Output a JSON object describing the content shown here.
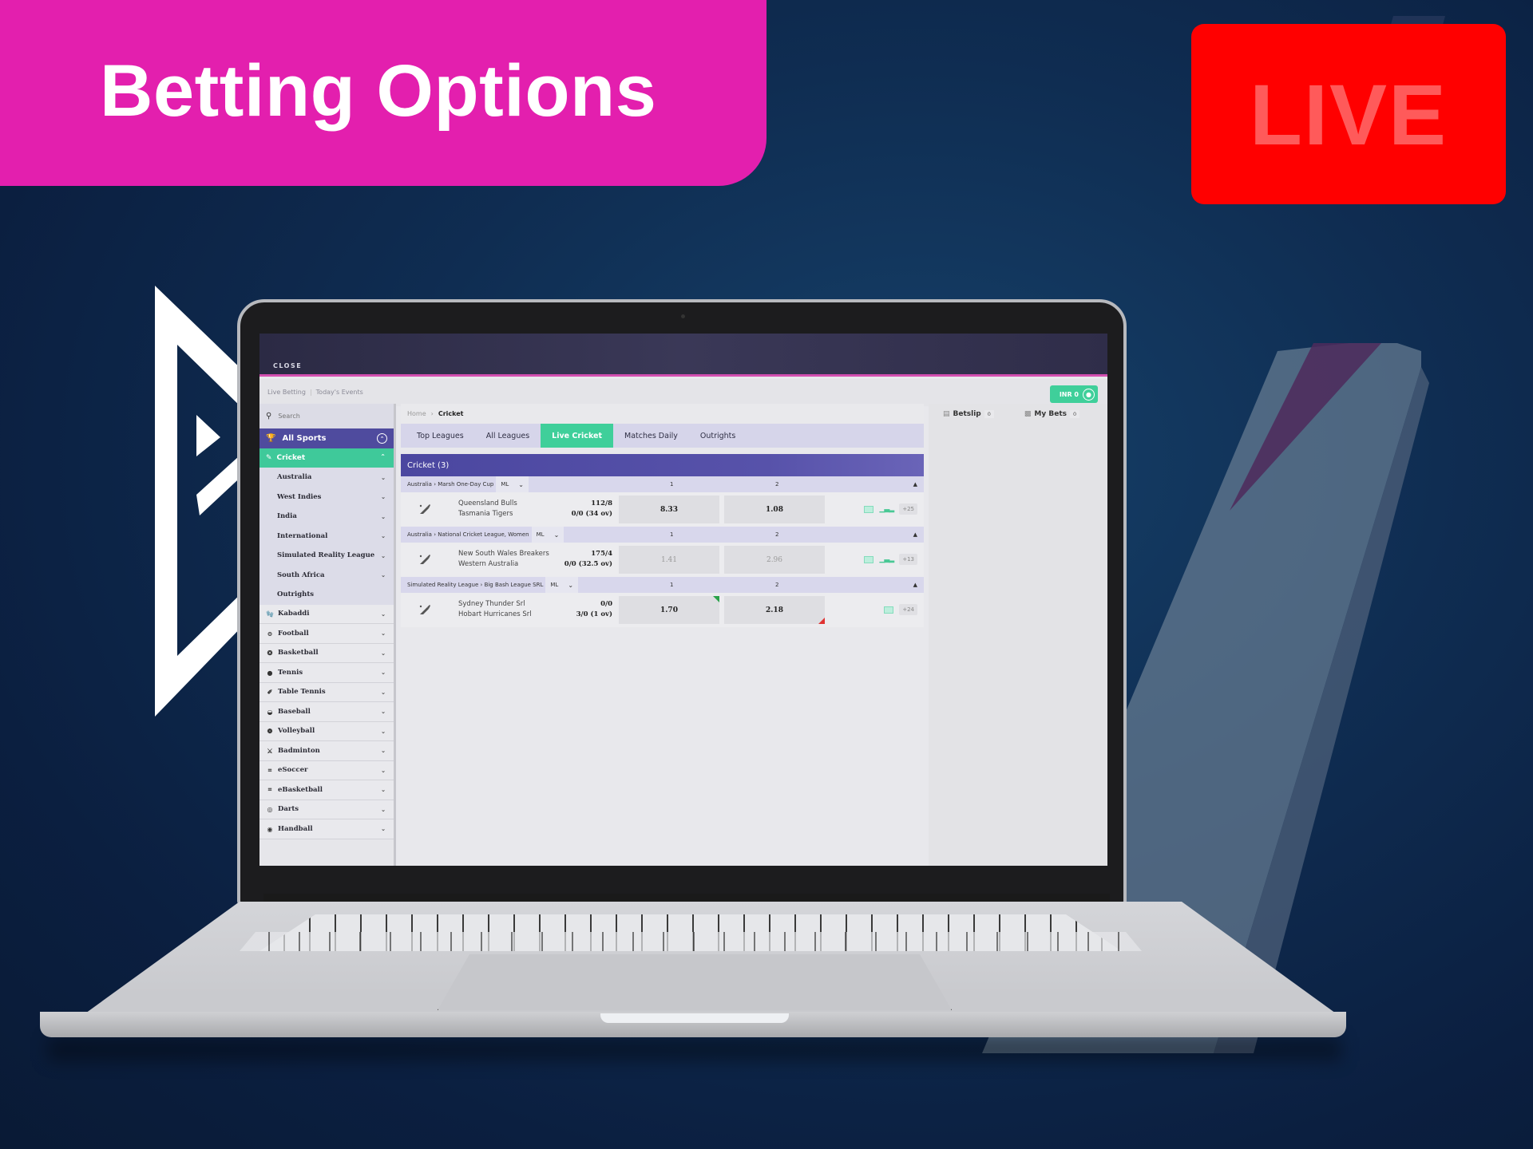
{
  "banner": {
    "title": "Betting Options"
  },
  "live_badge": {
    "label": "LIVE"
  },
  "colors": {
    "banner_bg": "#e31fae",
    "live_bg": "#ff0000",
    "accent_green": "#3fcf9a",
    "accent_purple": "#4f4b9e"
  },
  "app": {
    "close_label": "CLOSE",
    "crumbs": [
      "Live Betting",
      "Today's Events"
    ],
    "balance_label": "INR 0",
    "search_placeholder": "Search",
    "sidebar": {
      "all_sports": "All Sports",
      "active_sport": "Cricket",
      "sub_items": [
        {
          "label": "Australia",
          "has_chevron": true
        },
        {
          "label": "West Indies",
          "has_chevron": true
        },
        {
          "label": "India",
          "has_chevron": true
        },
        {
          "label": "International",
          "has_chevron": true
        },
        {
          "label": "Simulated Reality League",
          "has_chevron": true
        },
        {
          "label": "South Africa",
          "has_chevron": true
        },
        {
          "label": "Outrights",
          "has_chevron": false
        }
      ],
      "sports": [
        {
          "label": "Kabaddi",
          "icon": "kabaddi-icon"
        },
        {
          "label": "Football",
          "icon": "football-icon"
        },
        {
          "label": "Basketball",
          "icon": "basketball-icon"
        },
        {
          "label": "Tennis",
          "icon": "tennis-icon"
        },
        {
          "label": "Table Tennis",
          "icon": "table-tennis-icon"
        },
        {
          "label": "Baseball",
          "icon": "baseball-icon"
        },
        {
          "label": "Volleyball",
          "icon": "volleyball-icon"
        },
        {
          "label": "Badminton",
          "icon": "badminton-icon"
        },
        {
          "label": "eSoccer",
          "icon": "esoccer-icon"
        },
        {
          "label": "eBasketball",
          "icon": "ebasketball-icon"
        },
        {
          "label": "Darts",
          "icon": "darts-icon"
        },
        {
          "label": "Handball",
          "icon": "handball-icon"
        }
      ]
    },
    "breadcrumb": {
      "home": "Home",
      "current": "Cricket"
    },
    "tabs": [
      {
        "label": "Top Leagues",
        "active": false
      },
      {
        "label": "All Leagues",
        "active": false
      },
      {
        "label": "Live Cricket",
        "active": true
      },
      {
        "label": "Matches Daily",
        "active": false
      },
      {
        "label": "Outrights",
        "active": false
      }
    ],
    "category": "Cricket (3)",
    "col_headers": [
      "1",
      "2"
    ],
    "market": "ML",
    "leagues": [
      {
        "path": [
          "Australia",
          "Marsh One-Day Cup"
        ],
        "match": {
          "team1": "Queensland Bulls",
          "team2": "Tasmania Tigers",
          "score1": "112/8",
          "score2": "0/0 (34 ov)",
          "odd1": "8.33",
          "odd2": "1.08",
          "suspended": false,
          "odd1_trend": "",
          "odd2_trend": "",
          "has_field": true,
          "has_stats": true,
          "more_markets": "+25"
        }
      },
      {
        "path": [
          "Australia",
          "National Cricket League, Women"
        ],
        "match": {
          "team1": "New South Wales Breakers",
          "team2": "Western Australia",
          "score1": "175/4",
          "score2": "0/0 (32.5 ov)",
          "odd1": "1.41",
          "odd2": "2.96",
          "suspended": true,
          "odd1_trend": "",
          "odd2_trend": "",
          "has_field": true,
          "has_stats": true,
          "more_markets": "+13"
        }
      },
      {
        "path": [
          "Simulated Reality League",
          "Big Bash League SRL"
        ],
        "match": {
          "team1": "Sydney Thunder Srl",
          "team2": "Hobart Hurricanes Srl",
          "score1": "0/0",
          "score2": "3/0 (1 ov)",
          "odd1": "1.70",
          "odd2": "2.18",
          "suspended": false,
          "odd1_trend": "up",
          "odd2_trend": "down",
          "has_field": true,
          "has_stats": false,
          "more_markets": "+24"
        }
      }
    ],
    "right_panel": {
      "betslip_label": "Betslip",
      "betslip_count": "0",
      "mybets_label": "My Bets",
      "mybets_count": "0"
    }
  }
}
